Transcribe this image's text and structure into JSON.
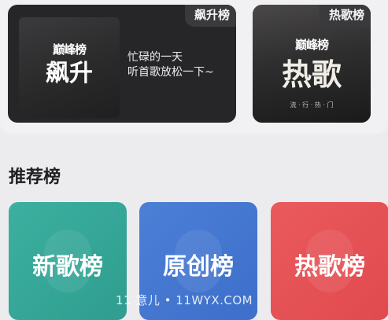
{
  "top_cards": [
    {
      "tag": "飙升榜",
      "cover_logo": "巅峰榜",
      "cover_title": "飙升",
      "desc_line1": "忙碌的一天",
      "desc_line2": "听首歌放松一下~"
    },
    {
      "tag": "热歌榜",
      "cover_logo": "巅峰榜",
      "cover_title": "热歌",
      "cover_caption": "流 · 行 · 热 · 门"
    }
  ],
  "section": {
    "title": "推荐榜"
  },
  "rank_cards": [
    {
      "label": "新歌榜",
      "color": "#33a696"
    },
    {
      "label": "原创榜",
      "color": "#4577d1"
    },
    {
      "label": "热歌榜",
      "color": "#e55256"
    }
  ],
  "watermark": "11 意儿 • 11WYX.COM"
}
